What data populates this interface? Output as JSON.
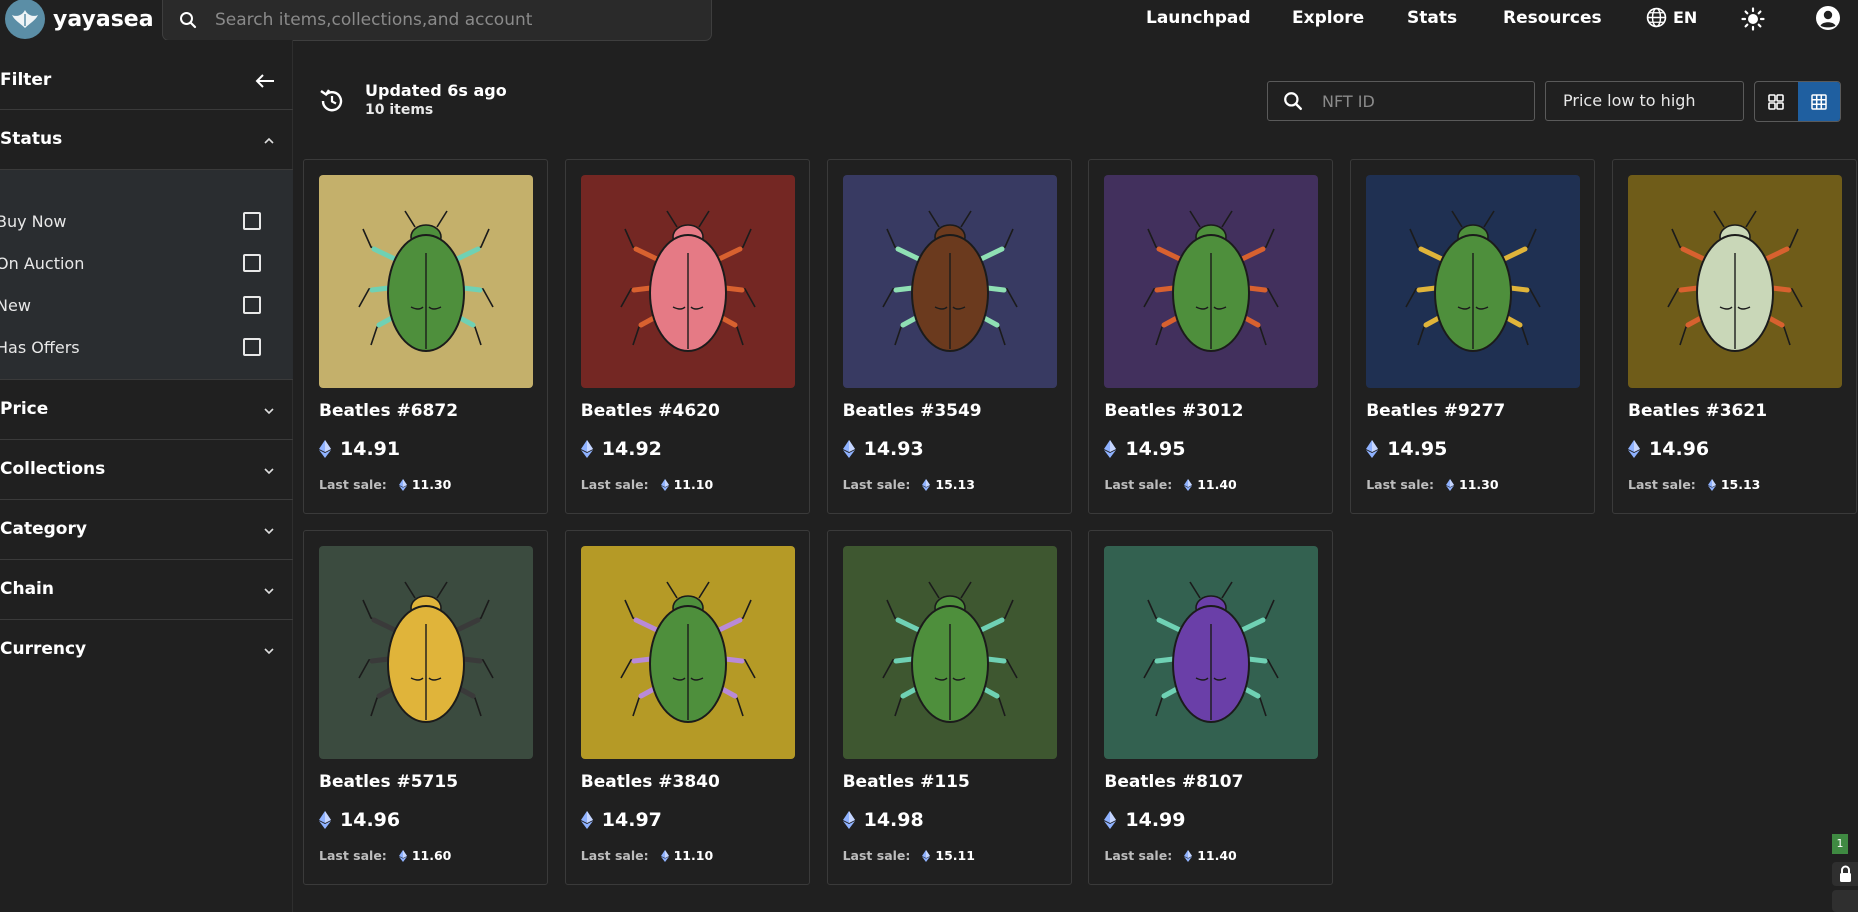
{
  "header": {
    "brand": "yayasea",
    "search_placeholder": "Search items,collections,and account",
    "nav": [
      "Launchpad",
      "Explore",
      "Stats",
      "Resources"
    ],
    "language": "EN"
  },
  "sidebar": {
    "title": "Filter",
    "status_title": "Status",
    "status_options": [
      "Buy Now",
      "On Auction",
      "New",
      "Has Offers"
    ],
    "sections": [
      "Price",
      "Collections",
      "Category",
      "Chain",
      "Currency"
    ]
  },
  "toolbar": {
    "updated": "Updated 6s ago",
    "count": "10 items",
    "nft_id_placeholder": "NFT ID",
    "sort": "Price low to high"
  },
  "last_sale_label": "Last sale:",
  "items": [
    {
      "name": "Beatles #6872",
      "price": "14.91",
      "last_sale": "11.30",
      "bg": "#c4b06b"
    },
    {
      "name": "Beatles #4620",
      "price": "14.92",
      "last_sale": "11.10",
      "bg": "#742723"
    },
    {
      "name": "Beatles #3549",
      "price": "14.93",
      "last_sale": "15.13",
      "bg": "#383a62"
    },
    {
      "name": "Beatles #3012",
      "price": "14.95",
      "last_sale": "11.40",
      "bg": "#42305d"
    },
    {
      "name": "Beatles #9277",
      "price": "14.95",
      "last_sale": "11.30",
      "bg": "#1f3052"
    },
    {
      "name": "Beatles #3621",
      "price": "14.96",
      "last_sale": "15.13",
      "bg": "#6f5c19"
    },
    {
      "name": "Beatles #5715",
      "price": "14.96",
      "last_sale": "11.60",
      "bg": "#3b4b3f"
    },
    {
      "name": "Beatles #3840",
      "price": "14.97",
      "last_sale": "11.10",
      "bg": "#b59a26"
    },
    {
      "name": "Beatles #115",
      "price": "14.98",
      "last_sale": "15.11",
      "bg": "#3e5730"
    },
    {
      "name": "Beatles #8107",
      "price": "14.99",
      "last_sale": "11.40",
      "bg": "#336150"
    }
  ],
  "corner_badge": "1"
}
